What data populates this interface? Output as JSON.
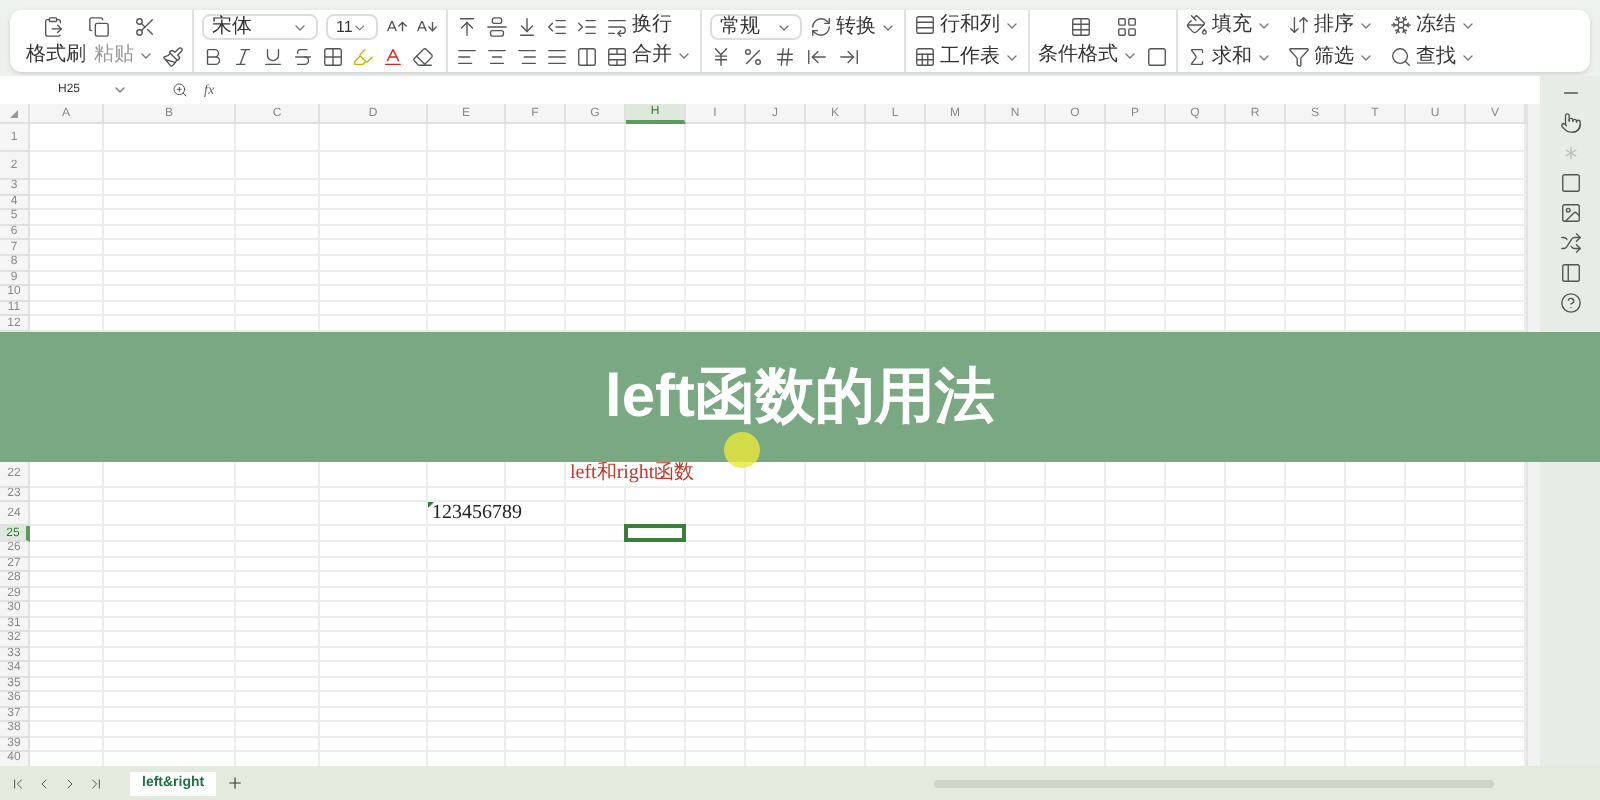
{
  "ribbon": {
    "format_painter": "格式刷",
    "paste": "粘贴",
    "font": {
      "name": "宋体",
      "size": "11"
    },
    "wrap": "换行",
    "merge": "合并",
    "number_format": "常规",
    "convert": "转换",
    "rows_columns": "行和列",
    "worksheet": "工作表",
    "conditional_format": "条件格式",
    "fill": "填充",
    "sort": "排序",
    "freeze": "冻结",
    "sum": "求和",
    "filter": "筛选",
    "find": "查找"
  },
  "formula_bar": {
    "name_box": "H25",
    "fx": "fx"
  },
  "columns": [
    {
      "label": "A",
      "selected": false
    },
    {
      "label": "B",
      "selected": false
    },
    {
      "label": "C",
      "selected": false
    },
    {
      "label": "D",
      "selected": false
    },
    {
      "label": "E",
      "selected": false
    },
    {
      "label": "F",
      "selected": false
    },
    {
      "label": "G",
      "selected": false
    },
    {
      "label": "H",
      "selected": true
    },
    {
      "label": "I",
      "selected": false
    },
    {
      "label": "J",
      "selected": false
    },
    {
      "label": "K",
      "selected": false
    },
    {
      "label": "L",
      "selected": false
    },
    {
      "label": "M",
      "selected": false
    },
    {
      "label": "N",
      "selected": false
    },
    {
      "label": "O",
      "selected": false
    },
    {
      "label": "P",
      "selected": false
    },
    {
      "label": "Q",
      "selected": false
    },
    {
      "label": "R",
      "selected": false
    },
    {
      "label": "S",
      "selected": false
    },
    {
      "label": "T",
      "selected": false
    },
    {
      "label": "U",
      "selected": false
    },
    {
      "label": "V",
      "selected": false
    }
  ],
  "rows_top": [
    {
      "label": "1",
      "selected": false
    },
    {
      "label": "2",
      "selected": false
    },
    {
      "label": "3",
      "selected": false
    },
    {
      "label": "4",
      "selected": false
    },
    {
      "label": "5",
      "selected": false
    },
    {
      "label": "6",
      "selected": false
    },
    {
      "label": "7",
      "selected": false
    },
    {
      "label": "8",
      "selected": false
    },
    {
      "label": "9",
      "selected": false
    },
    {
      "label": "10",
      "selected": false
    },
    {
      "label": "11",
      "selected": false
    },
    {
      "label": "12",
      "selected": false
    }
  ],
  "banner": {
    "title": "left函数的用法"
  },
  "rows_bottom": [
    {
      "label": "22",
      "selected": false,
      "cells": [
        {
          "kind": "note",
          "text": "left和right函数"
        }
      ]
    },
    {
      "label": "23",
      "selected": false
    },
    {
      "label": "24",
      "selected": false,
      "cells": [
        {
          "kind": "number",
          "text": "123456789"
        }
      ]
    },
    {
      "label": "25",
      "selected": true
    },
    {
      "label": "26",
      "selected": false
    },
    {
      "label": "27",
      "selected": false
    },
    {
      "label": "28",
      "selected": false
    },
    {
      "label": "29",
      "selected": false
    },
    {
      "label": "30",
      "selected": false
    },
    {
      "label": "31",
      "selected": false
    },
    {
      "label": "32",
      "selected": false
    },
    {
      "label": "33",
      "selected": false
    },
    {
      "label": "34",
      "selected": false
    },
    {
      "label": "35",
      "selected": false
    },
    {
      "label": "36",
      "selected": false
    },
    {
      "label": "37",
      "selected": false
    },
    {
      "label": "38",
      "selected": false
    },
    {
      "label": "39",
      "selected": false
    },
    {
      "label": "40",
      "selected": false
    }
  ],
  "sheet_tabs": [
    {
      "label": "left&right",
      "selected": true
    }
  ]
}
